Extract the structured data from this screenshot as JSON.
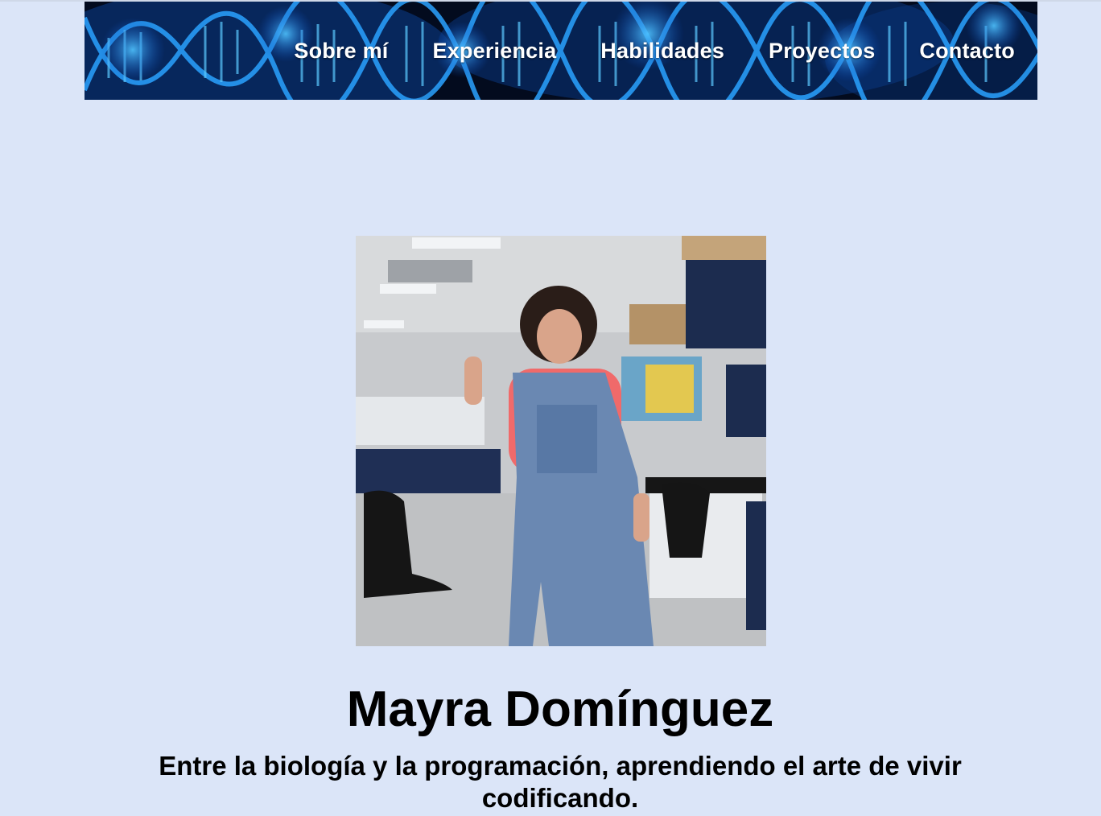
{
  "nav": {
    "items": [
      {
        "label": "Sobre mí"
      },
      {
        "label": "Experiencia"
      },
      {
        "label": "Habilidades"
      },
      {
        "label": "Proyectos"
      },
      {
        "label": "Contacto"
      }
    ]
  },
  "banner": {
    "image_description_icon": "dna-helix-background"
  },
  "profile": {
    "photo_icon": "profile-photo",
    "name": "Mayra Domínguez",
    "tagline": "Entre la biología y la programación, aprendiendo el arte de vivir codificando."
  },
  "colors": {
    "page_background": "#dbe5f8",
    "banner_blue": "#1e8cff",
    "nav_text": "#ffffff",
    "heading_text": "#000000"
  }
}
